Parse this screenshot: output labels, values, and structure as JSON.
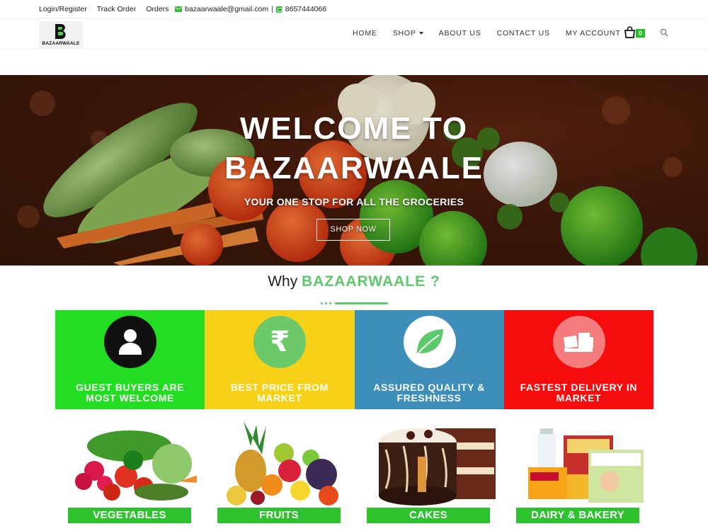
{
  "topbar": {
    "links": [
      "Login/Register",
      "Track Order",
      "Orders"
    ],
    "email": "bazaarwaale@gmail.com",
    "separator": "|",
    "phone": "8657444066"
  },
  "header": {
    "logo_text": "BAZAARWAALE",
    "logo_letter": "B",
    "nav": [
      {
        "label": "HOME"
      },
      {
        "label": "SHOP"
      },
      {
        "label": "ABOUT US"
      },
      {
        "label": "CONTACT US"
      },
      {
        "label": "MY ACCOUNT"
      }
    ],
    "cart_count": "0",
    "icons": {
      "cart": "shopping-bag-icon",
      "search": "search-icon"
    }
  },
  "hero": {
    "title_line1": "WELCOME TO",
    "title_line2": "BAZAARWAALE",
    "subtitle": "YOUR ONE STOP FOR ALL THE GROCERIES",
    "button": "SHOP NOW"
  },
  "why": {
    "prefix": "Why ",
    "accent": "BAZAARWAALE ?"
  },
  "features": [
    {
      "label_line1": "GUEST BUYERS ARE",
      "label_line2": "MOST WELCOME",
      "color": "#22dd22",
      "icon": "user-icon"
    },
    {
      "label_line1": "BEST PRICE FROM",
      "label_line2": "MARKET",
      "color": "#f7d117",
      "icon": "rupee-icon",
      "glyph": "₹"
    },
    {
      "label_line1": "ASSURED QUALITY &",
      "label_line2": "FRESHNESS",
      "color": "#3d8fb9",
      "icon": "leaf-icon"
    },
    {
      "label_line1": "FASTEST DELIVERY IN",
      "label_line2": "MARKET",
      "color": "#f50c0c",
      "icon": "truck-icon"
    }
  ],
  "categories": [
    {
      "label": "VEGETABLES"
    },
    {
      "label": "FRUITS"
    },
    {
      "label": "CAKES"
    },
    {
      "label": "DAIRY & BAKERY"
    }
  ],
  "colors": {
    "accent_green": "#5cc96a",
    "button_green": "#2fc22f"
  }
}
